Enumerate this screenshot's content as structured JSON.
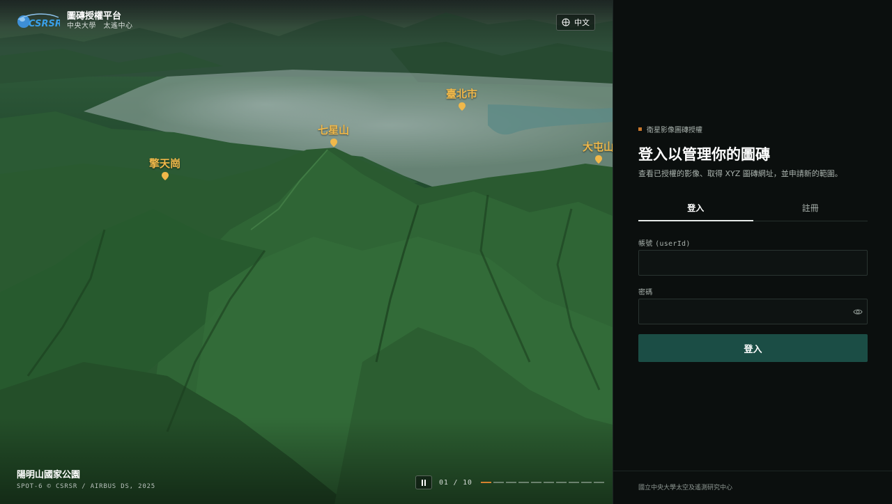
{
  "brand": {
    "logo_text": "CSRSR",
    "title": "圖磚授權平台",
    "subtitle": "中央大學　太遙中心"
  },
  "lang_button": {
    "label": "中文",
    "icon": "globe-icon"
  },
  "map_pins": [
    {
      "name": "擎天崗"
    },
    {
      "name": "七星山"
    },
    {
      "name": "臺北市"
    },
    {
      "name": "大屯山"
    }
  ],
  "slide": {
    "caption": "陽明山國家公園",
    "credit": "SPOT-6 © CSRSR / AIRBUS DS, 2025",
    "counter": "01 / 10",
    "current": 1,
    "total": 10
  },
  "login": {
    "eyebrow": "衛星影像圖磚授權",
    "title": "登入以管理你的圖磚",
    "subtitle": "查看已授權的影像、取得 XYZ 圖磚網址，並申請新的範圍。",
    "tabs": [
      {
        "label": "登入",
        "active": true
      },
      {
        "label": "註冊",
        "active": false
      }
    ],
    "account_label": "帳號",
    "account_label_mono": "(userId)",
    "account_value": "",
    "password_label": "密碼",
    "password_value": "",
    "submit_label": "登入"
  },
  "footer": {
    "text": "國立中央大學太空及遙測研究中心"
  },
  "colors": {
    "accent": "#c8772b",
    "button": "#1b4d45",
    "panel_bg": "#0b0f0e",
    "pin": "#f0b84a"
  }
}
